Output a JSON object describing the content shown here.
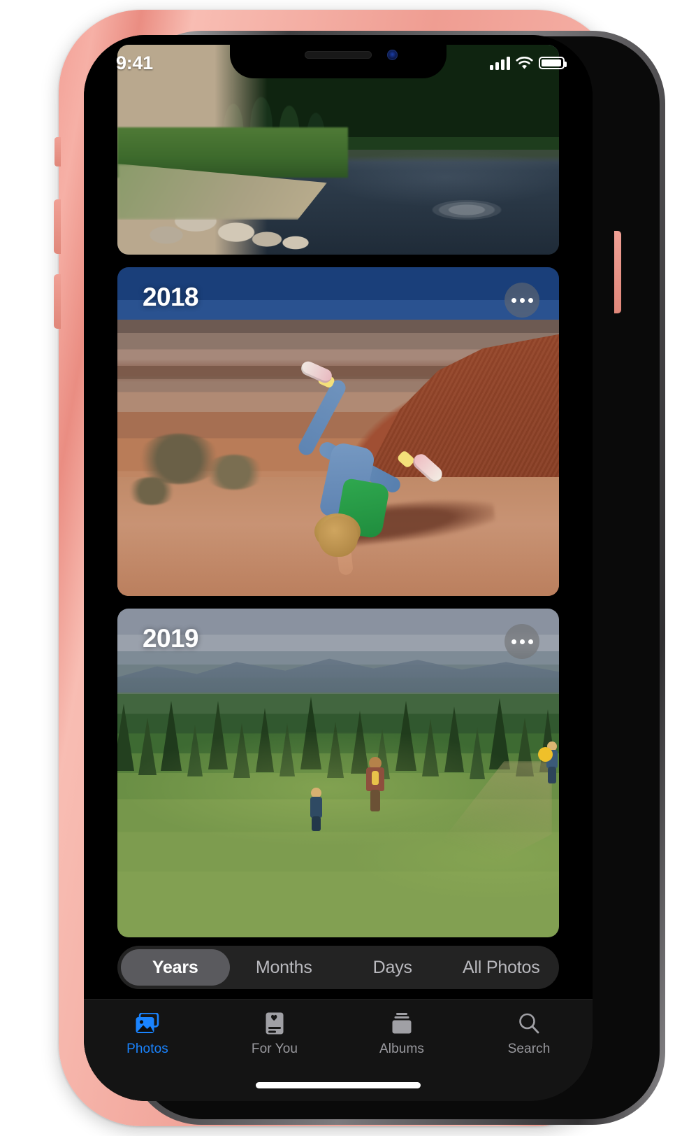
{
  "device": {
    "name": "iPhone XR",
    "frame_color": "#ef9d92",
    "mute_switch": "mute-switch",
    "volume_up": "volume-up-button",
    "volume_down": "volume-down-button",
    "power": "side-power-button"
  },
  "status_bar": {
    "time": "9:41",
    "cellular_icon": "cellular-signal-icon",
    "cellular_bars": 4,
    "wifi_icon": "wifi-icon",
    "battery_icon": "battery-icon",
    "battery_full": true
  },
  "app": {
    "name": "Photos",
    "screen": "Years"
  },
  "cards": [
    {
      "id": "card-2017",
      "label": "",
      "has_more_button": false,
      "description": "Lake shoreline with rocks, water ripples and evergreen forest"
    },
    {
      "id": "card-2018",
      "label": "2018",
      "has_more_button": true,
      "more_button_label": "more-options",
      "description": "Child doing a cartwheel in front of red painted hills"
    },
    {
      "id": "card-2019",
      "label": "2019",
      "has_more_button": true,
      "more_button_label": "more-options",
      "description": "Three children walking through a green alpine meadow with conifers"
    }
  ],
  "segmented_control": {
    "selected": "Years",
    "options": [
      {
        "label": "Years",
        "active": true
      },
      {
        "label": "Months",
        "active": false
      },
      {
        "label": "Days",
        "active": false
      },
      {
        "label": "All Photos",
        "active": false
      }
    ]
  },
  "tab_bar": {
    "active": "Photos",
    "accent_color": "#1a84ff",
    "inactive_color": "#9a9a9f",
    "tabs": [
      {
        "label": "Photos",
        "icon": "photos-icon",
        "active": true
      },
      {
        "label": "For You",
        "icon": "for-you-icon",
        "active": false
      },
      {
        "label": "Albums",
        "icon": "albums-icon",
        "active": false
      },
      {
        "label": "Search",
        "icon": "search-icon",
        "active": false
      }
    ]
  },
  "home_indicator": "home-indicator"
}
